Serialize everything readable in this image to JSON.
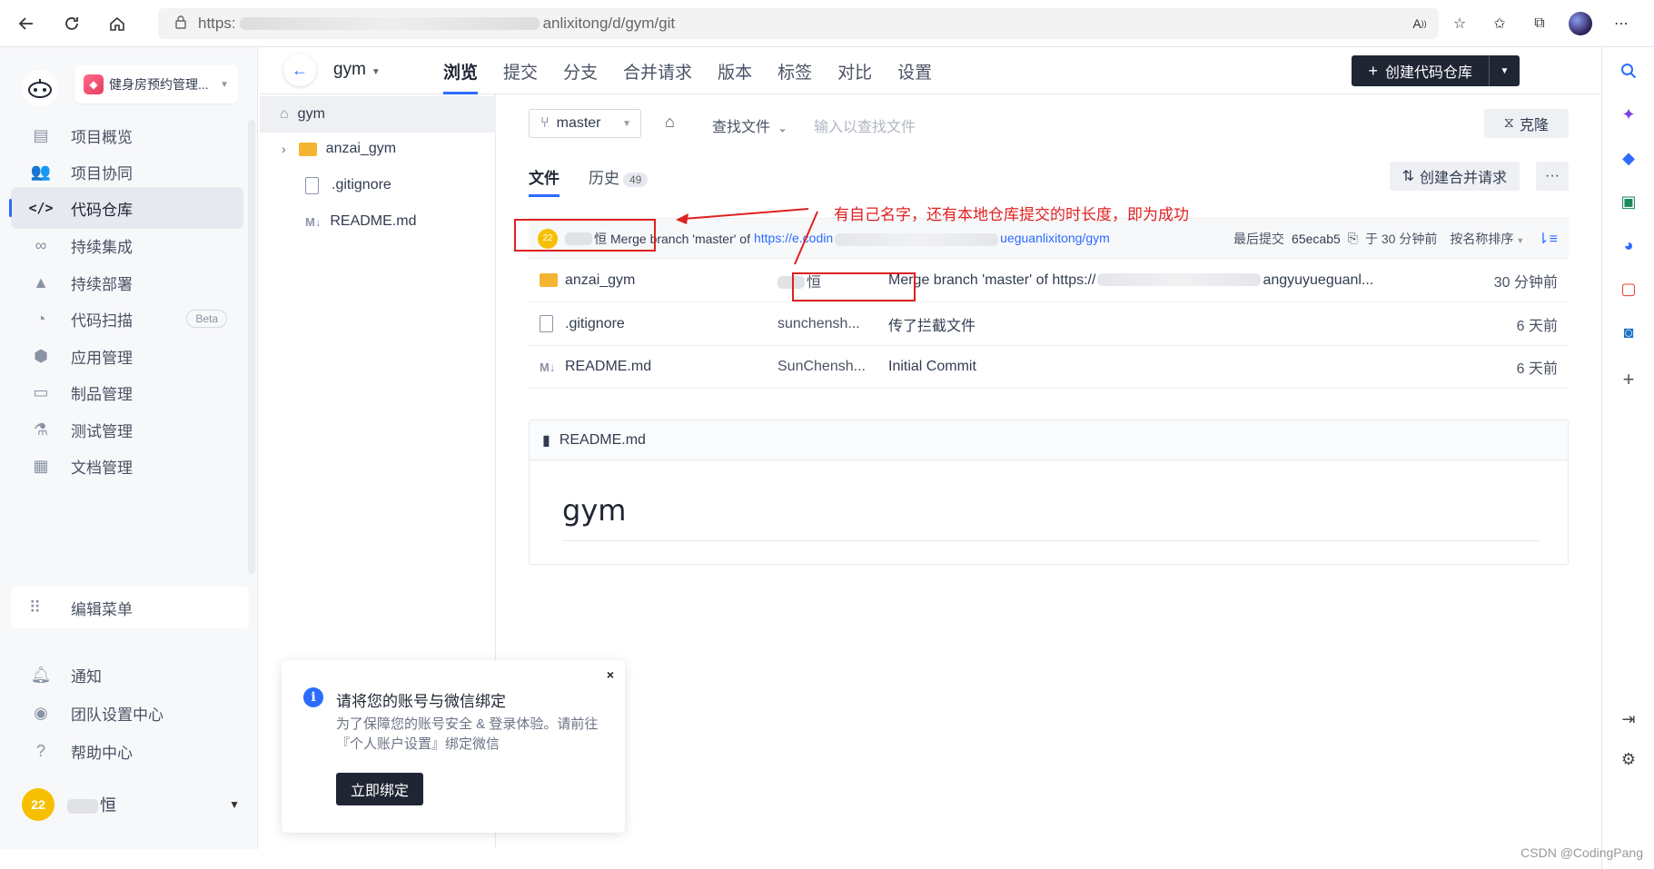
{
  "browser": {
    "url_prefix": "https:",
    "url_suffix": "anlixitong/d/gym/git"
  },
  "sidebar": {
    "project_name": "健身房预约管理...",
    "items": [
      {
        "label": "项目概览",
        "icon": "overview-icon"
      },
      {
        "label": "项目协同",
        "icon": "collab-icon"
      },
      {
        "label": "代码仓库",
        "icon": "code-icon"
      },
      {
        "label": "持续集成",
        "icon": "ci-icon"
      },
      {
        "label": "持续部署",
        "icon": "rocket-icon"
      },
      {
        "label": "代码扫描",
        "icon": "scan-icon",
        "badge": "Beta"
      },
      {
        "label": "应用管理",
        "icon": "app-icon"
      },
      {
        "label": "制品管理",
        "icon": "artifact-icon"
      },
      {
        "label": "测试管理",
        "icon": "test-icon"
      },
      {
        "label": "文档管理",
        "icon": "doc-icon"
      }
    ],
    "edit_menu": "编辑菜单",
    "bottom_items": [
      {
        "label": "通知",
        "icon": "bell-icon"
      },
      {
        "label": "团队设置中心",
        "icon": "team-settings-icon"
      },
      {
        "label": "帮助中心",
        "icon": "help-icon"
      }
    ],
    "user": {
      "avatar_text": "22",
      "name": "恒"
    }
  },
  "header": {
    "repo": "gym",
    "tabs": [
      "浏览",
      "提交",
      "分支",
      "合并请求",
      "版本",
      "标签",
      "对比",
      "设置"
    ],
    "create_button": "创建代码仓库"
  },
  "tree": {
    "root": "gym",
    "items": [
      {
        "name": "anzai_gym",
        "type": "folder"
      },
      {
        "name": ".gitignore",
        "type": "file"
      },
      {
        "name": "README.md",
        "type": "markdown"
      }
    ]
  },
  "main": {
    "branch": "master",
    "find_file": "查找文件",
    "find_placeholder": "输入以查找文件",
    "clone": "克隆",
    "subtabs": {
      "files": "文件",
      "history": "历史",
      "history_count": "49"
    },
    "create_mr": "创建合并请求",
    "more": "···",
    "last_commit": {
      "avatar_text": "22",
      "author": "恒",
      "message": "Merge branch 'master' of",
      "link_start": "https://e.codin",
      "link_end": "ueguanlixitong/gym",
      "label": "最后提交",
      "hash": "65ecab5",
      "time": "于 30 分钟前",
      "sort": "按名称排序"
    },
    "files": [
      {
        "name": "anzai_gym",
        "type": "folder",
        "author": "恒",
        "message": "Merge branch 'master' of https://",
        "message_end": "angyuyueguanl...",
        "time": "30 分钟前"
      },
      {
        "name": ".gitignore",
        "type": "file",
        "author": "sunchensh...",
        "message": "传了拦截文件",
        "time": "6 天前"
      },
      {
        "name": "README.md",
        "type": "markdown",
        "author": "SunChensh...",
        "message": "Initial Commit",
        "time": "6 天前"
      }
    ],
    "readme": {
      "filename": "README.md",
      "heading": "gym"
    }
  },
  "annotation": {
    "text": "有自己名字，还有本地仓库提交的时长度，即为成功"
  },
  "notice": {
    "title": "请将您的账号与微信绑定",
    "desc": "为了保障您的账号安全 & 登录体验。请前往『个人账户设置』绑定微信",
    "button": "立即绑定",
    "close": "×"
  },
  "watermark": "CSDN @CodingPang",
  "colors": {
    "accent": "#2c6bff",
    "dark": "#1f2533",
    "annotation": "#e02020",
    "folder": "#f5b432",
    "avatar": "#f6c000"
  }
}
